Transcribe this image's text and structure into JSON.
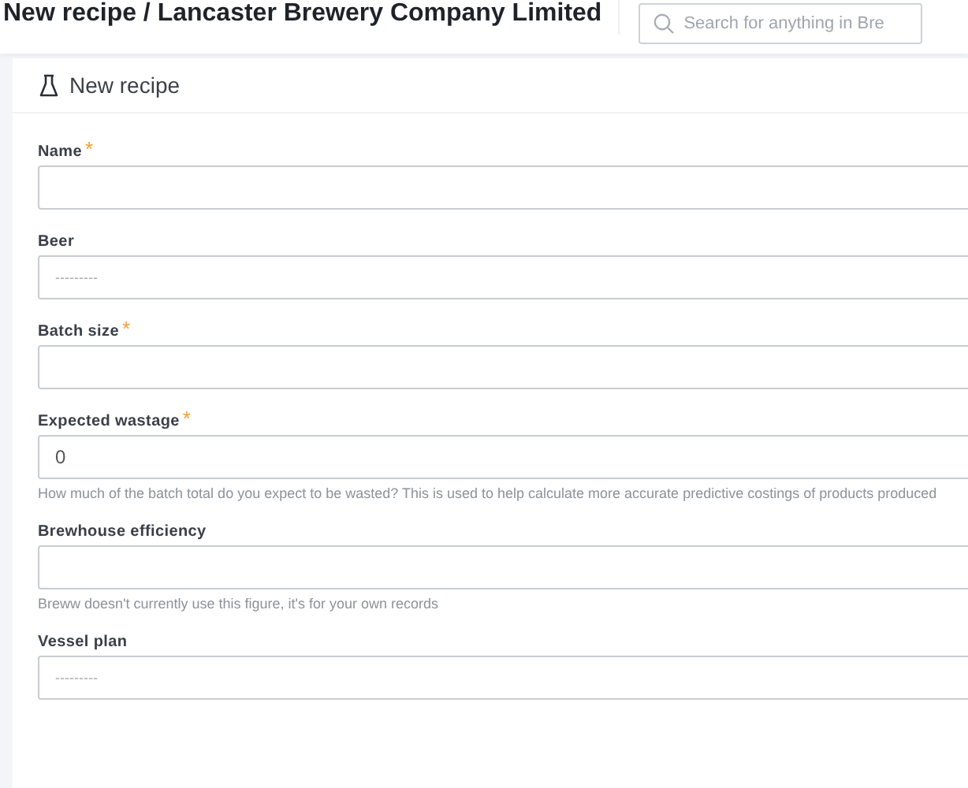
{
  "header": {
    "title": "New recipe / Lancaster Brewery Company Limited",
    "search": {
      "placeholder": "Search for anything in Bre"
    }
  },
  "card": {
    "title": "New recipe"
  },
  "required_mark": "*",
  "fields": [
    {
      "label": "Name",
      "required": true,
      "kind": "text"
    },
    {
      "label": "Beer",
      "required": false,
      "kind": "select",
      "placeholder": "---------"
    },
    {
      "label": "Batch size",
      "required": true,
      "kind": "text"
    },
    {
      "label": "Expected wastage",
      "required": true,
      "kind": "text",
      "value": "0",
      "help": "How much of the batch total do you expect to be wasted? This is used to help calculate more accurate predictive costings of products produced"
    },
    {
      "label": "Brewhouse efficiency",
      "required": false,
      "kind": "text",
      "help": "Breww doesn't currently use this figure, it's for your own records"
    },
    {
      "label": "Vessel plan",
      "required": false,
      "kind": "select",
      "placeholder": "---------"
    }
  ]
}
